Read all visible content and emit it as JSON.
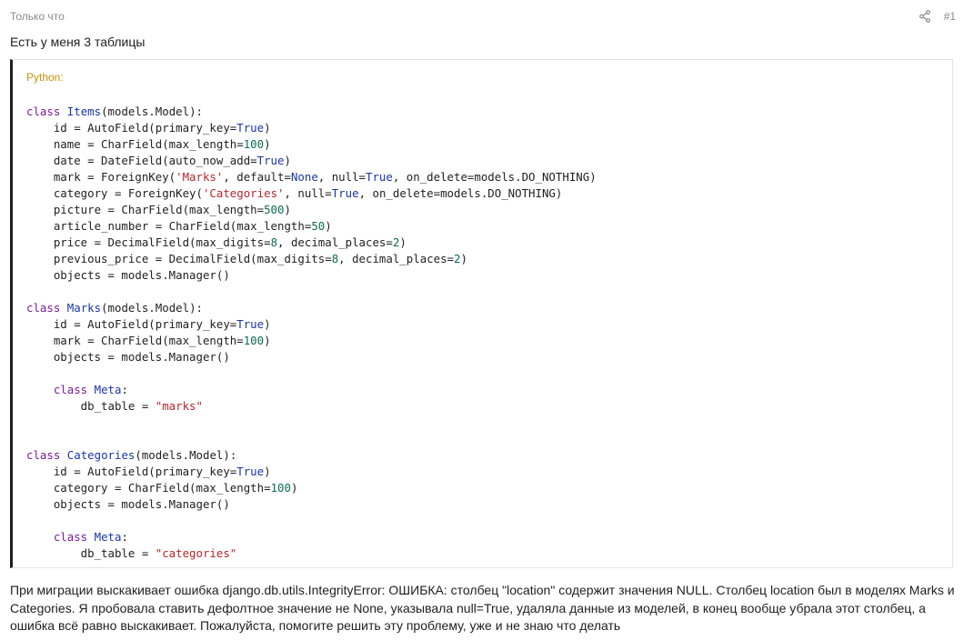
{
  "post": {
    "timestamp": "Только что",
    "number": "#1",
    "share_icon": "share-icon",
    "intro": "Есть у меня 3 таблицы",
    "description": "При миграции выскакивает ошибка django.db.utils.IntegrityError: ОШИБКА: столбец \"location\" содержит значения NULL. Столбец location был в моделях Marks и Categories. Я пробовала ставить дефолтное значение не None, указывала null=True, удаляла данные из моделей, в конец вообще убрала этот столбец, а ошибка всё равно выскакивает. Пожалуйста, помогите решить эту проблему, уже и не знаю что делать"
  },
  "code_block": {
    "language": "Python:",
    "colors": {
      "keyword": "#7a1c99",
      "class_name": "#1a35a8",
      "boolean": "#1a35a8",
      "number": "#0a6b52",
      "string": "#b5272c",
      "lang_label": "#c8920a"
    },
    "lines": [
      [
        [
          "kw",
          "class"
        ],
        [
          "plain",
          " "
        ],
        [
          "cls",
          "Items"
        ],
        [
          "plain",
          "(models.Model):"
        ]
      ],
      [
        [
          "plain",
          "    id = AutoField(primary_key="
        ],
        [
          "bool",
          "True"
        ],
        [
          "plain",
          ")"
        ]
      ],
      [
        [
          "plain",
          "    name = CharField(max_length="
        ],
        [
          "num",
          "100"
        ],
        [
          "plain",
          ")"
        ]
      ],
      [
        [
          "plain",
          "    date = DateField(auto_now_add="
        ],
        [
          "bool",
          "True"
        ],
        [
          "plain",
          ")"
        ]
      ],
      [
        [
          "plain",
          "    mark = ForeignKey("
        ],
        [
          "str",
          "'Marks'"
        ],
        [
          "plain",
          ", default="
        ],
        [
          "bool",
          "None"
        ],
        [
          "plain",
          ", null="
        ],
        [
          "bool",
          "True"
        ],
        [
          "plain",
          ", on_delete=models.DO_NOTHING)"
        ]
      ],
      [
        [
          "plain",
          "    category = ForeignKey("
        ],
        [
          "str",
          "'Categories'"
        ],
        [
          "plain",
          ", null="
        ],
        [
          "bool",
          "True"
        ],
        [
          "plain",
          ", on_delete=models.DO_NOTHING)"
        ]
      ],
      [
        [
          "plain",
          "    picture = CharField(max_length="
        ],
        [
          "num",
          "500"
        ],
        [
          "plain",
          ")"
        ]
      ],
      [
        [
          "plain",
          "    article_number = CharField(max_length="
        ],
        [
          "num",
          "50"
        ],
        [
          "plain",
          ")"
        ]
      ],
      [
        [
          "plain",
          "    price = DecimalField(max_digits="
        ],
        [
          "num",
          "8"
        ],
        [
          "plain",
          ", decimal_places="
        ],
        [
          "num",
          "2"
        ],
        [
          "plain",
          ")"
        ]
      ],
      [
        [
          "plain",
          "    previous_price = DecimalField(max_digits="
        ],
        [
          "num",
          "8"
        ],
        [
          "plain",
          ", decimal_places="
        ],
        [
          "num",
          "2"
        ],
        [
          "plain",
          ")"
        ]
      ],
      [
        [
          "plain",
          "    objects = models.Manager()"
        ]
      ],
      [],
      [
        [
          "kw",
          "class"
        ],
        [
          "plain",
          " "
        ],
        [
          "cls",
          "Marks"
        ],
        [
          "plain",
          "(models.Model):"
        ]
      ],
      [
        [
          "plain",
          "    id = AutoField(primary_key="
        ],
        [
          "bool",
          "True"
        ],
        [
          "plain",
          ")"
        ]
      ],
      [
        [
          "plain",
          "    mark = CharField(max_length="
        ],
        [
          "num",
          "100"
        ],
        [
          "plain",
          ")"
        ]
      ],
      [
        [
          "plain",
          "    objects = models.Manager()"
        ]
      ],
      [],
      [
        [
          "plain",
          "    "
        ],
        [
          "kw",
          "class"
        ],
        [
          "plain",
          " "
        ],
        [
          "cls",
          "Meta"
        ],
        [
          "plain",
          ":"
        ]
      ],
      [
        [
          "plain",
          "        db_table = "
        ],
        [
          "str",
          "\"marks\""
        ]
      ],
      [],
      [],
      [
        [
          "kw",
          "class"
        ],
        [
          "plain",
          " "
        ],
        [
          "cls",
          "Categories"
        ],
        [
          "plain",
          "(models.Model):"
        ]
      ],
      [
        [
          "plain",
          "    id = AutoField(primary_key="
        ],
        [
          "bool",
          "True"
        ],
        [
          "plain",
          ")"
        ]
      ],
      [
        [
          "plain",
          "    category = CharField(max_length="
        ],
        [
          "num",
          "100"
        ],
        [
          "plain",
          ")"
        ]
      ],
      [
        [
          "plain",
          "    objects = models.Manager()"
        ]
      ],
      [],
      [
        [
          "plain",
          "    "
        ],
        [
          "kw",
          "class"
        ],
        [
          "plain",
          " "
        ],
        [
          "cls",
          "Meta"
        ],
        [
          "plain",
          ":"
        ]
      ],
      [
        [
          "plain",
          "        db_table = "
        ],
        [
          "str",
          "\"categories\""
        ]
      ]
    ]
  }
}
